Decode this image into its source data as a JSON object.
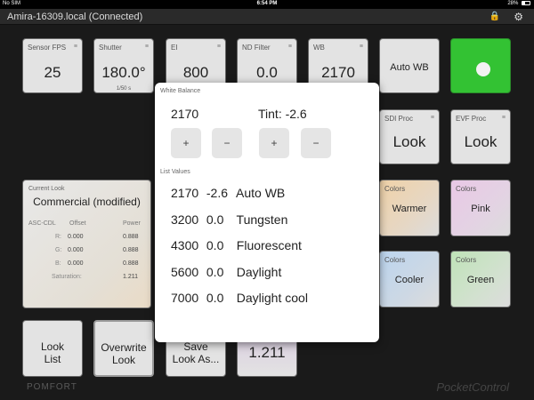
{
  "status_bar": {
    "carrier": "No SIM",
    "time": "6:54 PM",
    "battery": "28%"
  },
  "titlebar": {
    "title": "Amira-16309.local (Connected)",
    "lock_icon": "lock-icon",
    "gear_icon": "gear-icon"
  },
  "tiles": {
    "sensor_fps": {
      "label": "Sensor FPS",
      "value": "25"
    },
    "shutter": {
      "label": "Shutter",
      "value": "180.0°",
      "sub": "1/50 s"
    },
    "ei": {
      "label": "EI",
      "value": "800"
    },
    "nd": {
      "label": "ND Filter",
      "value": "0.0"
    },
    "wb": {
      "label": "WB",
      "value": "2170"
    },
    "auto_wb": {
      "label": "Auto WB"
    },
    "sdi": {
      "label": "SDI Proc",
      "value": "Look"
    },
    "evf": {
      "label": "EVF Proc",
      "value": "Look"
    },
    "warmer": {
      "label": "Colors",
      "value": "Warmer"
    },
    "pink": {
      "label": "Colors",
      "value": "Pink"
    },
    "cooler": {
      "label": "Colors",
      "value": "Cooler"
    },
    "green": {
      "label": "Colors",
      "value": "Green"
    },
    "saturation_tile": {
      "value": "1.211"
    }
  },
  "current_look": {
    "label": "Current Look",
    "name": "Commercial (modified)",
    "cdl_header": "ASC-CDL",
    "offset_header": "Offset",
    "power_header": "Power",
    "rows": [
      {
        "ch": "R:",
        "offset": "0.000",
        "power": "0.888"
      },
      {
        "ch": "G:",
        "offset": "0.000",
        "power": "0.888"
      },
      {
        "ch": "B:",
        "offset": "0.000",
        "power": "0.888"
      }
    ],
    "saturation_label": "Saturation:",
    "saturation_value": "1.211"
  },
  "bottom_buttons": {
    "look_list": {
      "line1": "Look",
      "line2": "List"
    },
    "overwrite_look": {
      "line1": "Overwrite",
      "line2": "Look"
    },
    "save_look": {
      "line1": "Save",
      "line2": "Look As..."
    }
  },
  "brand": {
    "left": "POMFORT",
    "right": "PocketControl"
  },
  "modal": {
    "title": "White Balance",
    "wb_value": "2170",
    "tint_value": "Tint: -2.6",
    "plus": "+",
    "minus": "−",
    "list_title": "List Values",
    "list": [
      {
        "kelvin": "2170",
        "tint": "-2.6",
        "name": "Auto WB"
      },
      {
        "kelvin": "3200",
        "tint": "0.0",
        "name": "Tungsten"
      },
      {
        "kelvin": "4300",
        "tint": "0.0",
        "name": "Fluorescent"
      },
      {
        "kelvin": "5600",
        "tint": "0.0",
        "name": "Daylight"
      },
      {
        "kelvin": "7000",
        "tint": "0.0",
        "name": "Daylight cool"
      }
    ]
  },
  "colors": {
    "accent_green": "#33c233",
    "tile_bg": "#e3e3e3"
  }
}
